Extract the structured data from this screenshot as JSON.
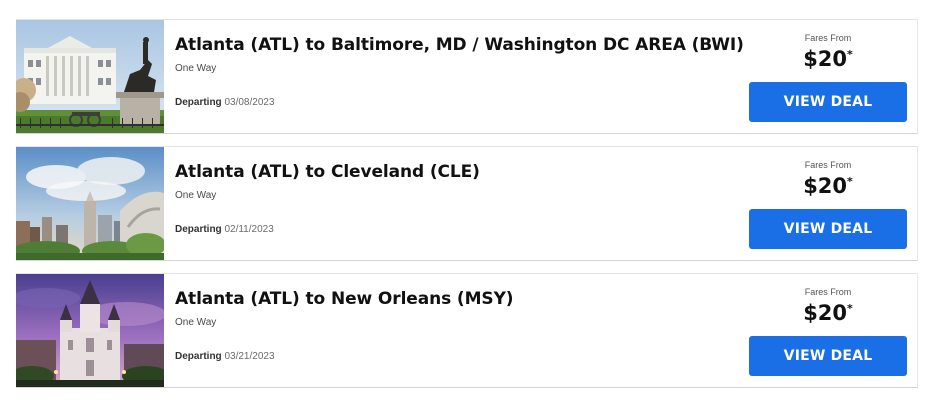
{
  "deals": [
    {
      "route": "Atlanta (ATL) to Baltimore, MD / Washington DC AREA (BWI)",
      "trip_type": "One Way",
      "departing_label": "Departing",
      "departing_date": "03/08/2023",
      "fares_from_label": "Fares From",
      "price": "$20",
      "price_mark": "*",
      "button_label": "VIEW DEAL",
      "image": "white-house-photo"
    },
    {
      "route": "Atlanta (ATL) to Cleveland (CLE)",
      "trip_type": "One Way",
      "departing_label": "Departing",
      "departing_date": "02/11/2023",
      "fares_from_label": "Fares From",
      "price": "$20",
      "price_mark": "*",
      "button_label": "VIEW DEAL",
      "image": "cleveland-skyline-photo"
    },
    {
      "route": "Atlanta (ATL) to New Orleans (MSY)",
      "trip_type": "One Way",
      "departing_label": "Departing",
      "departing_date": "03/21/2023",
      "fares_from_label": "Fares From",
      "price": "$20",
      "price_mark": "*",
      "button_label": "VIEW DEAL",
      "image": "st-louis-cathedral-photo"
    }
  ],
  "colors": {
    "button": "#1a6fe6",
    "button_text": "#ffffff"
  }
}
